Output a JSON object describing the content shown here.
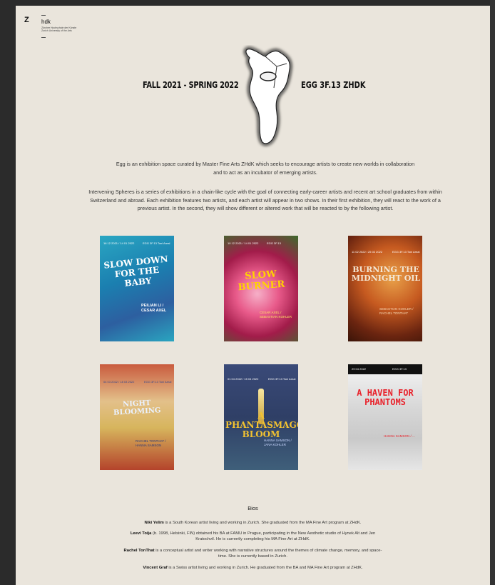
{
  "logo": {
    "mark": "Z",
    "name": "hdk",
    "lines": [
      "Zürcher Hochschule der Künste",
      "Zurich University of the Arts"
    ]
  },
  "hero": {
    "left": "FALL 2021 - SPRING 2022",
    "right": "EGG 3F.13 ZHDK"
  },
  "intro": [
    "Egg is an exhibition space curated by Master Fine Arts ZHdK which seeks to encourage artists to create new worlds in collaboration and to act as an incubator of emerging artists.",
    "Intervening Spheres is a series of exhibitions in a chain-like cycle with the goal of connecting early-career artists and recent art school graduates from within Switzerland and abroad. Each exhibition features two artists, and each artist will appear in two shows. In their first exhibition, they will react to the work of a previous artist. In the second, they will show different or altered work that will be reacted to by the following artist."
  ],
  "posters": [
    {
      "title": "SLOW DOWN FOR THE BABY",
      "dates": "16 12 2021 / 14 01 2022",
      "venue": "EGG 3F.13 Toni Areal",
      "names": "PEILIAN LI / CESAR AXEL",
      "color": "#ffffff"
    },
    {
      "title": "SLOW BURNER",
      "dates": "10 12 2021 / 14 01 2022",
      "venue": "EGG 3F.13",
      "names": "CESAR AXEL / SEBASTIAN KOHLER",
      "color": "#ffd400"
    },
    {
      "title": "BURNING THE MIDNIGHT OIL",
      "dates": "11 02 2022 / 25 02 2022",
      "venue": "EGG 3F.13 Toni Areal",
      "names": "SEBASTIAN KOHLER / RACHEL TONTHAT",
      "color": "#f3e6d4"
    },
    {
      "title": "NIGHT BLOOMING",
      "dates": "04 03 2022 / 18 03 2022",
      "venue": "EGG 3F.13 Toni Areal",
      "names": "RACHEL TONTHAT / HANNA SAMSON",
      "color": "#eaf2ff"
    },
    {
      "title": "A PHANTASMAGORICAL BLOOM",
      "dates": "01 04 2022 / 15 04 2022",
      "venue": "EGG 3F.13 Toni Areal",
      "names": "HANNA SAMSON / JANA KOHLER",
      "color": "#f2c230"
    },
    {
      "title": "A HAVEN FOR PHANTOMS",
      "dates": "29 04 2022",
      "venue": "EGG 3F.13",
      "names": "HANNA SAMSON / ...",
      "color": "#e8222b"
    }
  ],
  "bios": {
    "heading": "Bios",
    "items": [
      {
        "name": "Niki Yelim",
        "text": " is a South Korean artist living and working in Zurich. She graduated from the MA Fine Art program at ZHdK."
      },
      {
        "name": "Leevi Toija",
        "text": " (b. 1998, Helsinki, FIN) obtained his BA at FAMU in Prague, participating in the New Aesthetic studio of Hynek Alt and Jen Kratochvil. He is currently completing his MA Fine Art at ZHdK."
      },
      {
        "name": "Rachel TonThat",
        "text": " is a conceptual artist and writer working with narrative structures around the themes of climate change, memory, and space-time. She is currently based in Zurich."
      },
      {
        "name": "Vincent Graf",
        "text": " is a Swiss artist living and working in Zurich. He graduated from the BA and MA Fine Art program at ZHdK."
      }
    ]
  }
}
